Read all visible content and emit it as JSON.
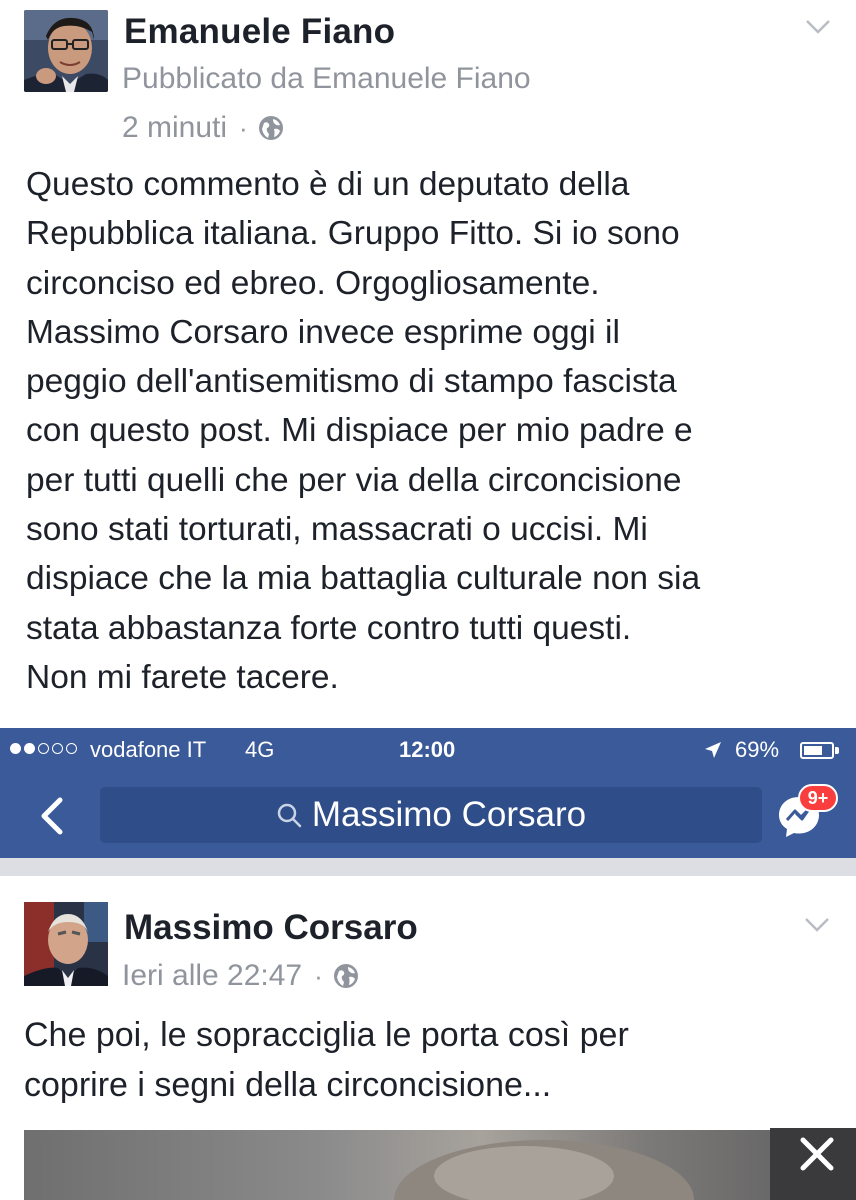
{
  "post": {
    "author": "Emanuele Fiano",
    "published_by": "Pubblicato da Emanuele Fiano",
    "time": "2 minuti",
    "separator": "·",
    "body_lines": [
      "Questo commento è di un deputato della",
      "Repubblica italiana. Gruppo Fitto. Si io sono",
      "circonciso ed ebreo. Orgogliosamente.",
      "Massimo Corsaro invece esprime oggi il",
      "peggio dell'antisemitismo di stampo fascista",
      "con questo post. Mi dispiace per mio padre e",
      "per tutti quelli che per via della circoncisione",
      "sono stati torturati, massacrati o uccisi. Mi",
      "dispiace che la mia battaglia culturale non sia",
      "stata abbastanza forte contro tutti questi.",
      "Non mi farete tacere."
    ]
  },
  "screenshot": {
    "status_bar": {
      "signal_bars_filled": 2,
      "signal_bars_total": 5,
      "carrier": "vodafone IT",
      "network": "4G",
      "clock": "12:00",
      "battery": "69%",
      "battery_level": 0.69
    },
    "nav": {
      "search_text": "Massimo Corsaro",
      "messenger_badge": "9+"
    },
    "inner_post": {
      "author": "Massimo Corsaro",
      "time": "Ieri alle 22:47",
      "separator": "·",
      "body_lines": [
        "Che poi, le sopracciglia le porta così per",
        "coprire i segni della circoncisione..."
      ]
    }
  },
  "colors": {
    "facebook_blue": "#3b5a9a",
    "search_field": "#2f4d88",
    "meta_gray": "#90949c",
    "text": "#1d2129",
    "badge_red": "#fa3e3e"
  },
  "icons": [
    "globe-icon",
    "chevron-down-icon",
    "back-arrow-icon",
    "search-icon",
    "messenger-icon",
    "location-arrow-icon",
    "battery-icon",
    "close-icon"
  ]
}
